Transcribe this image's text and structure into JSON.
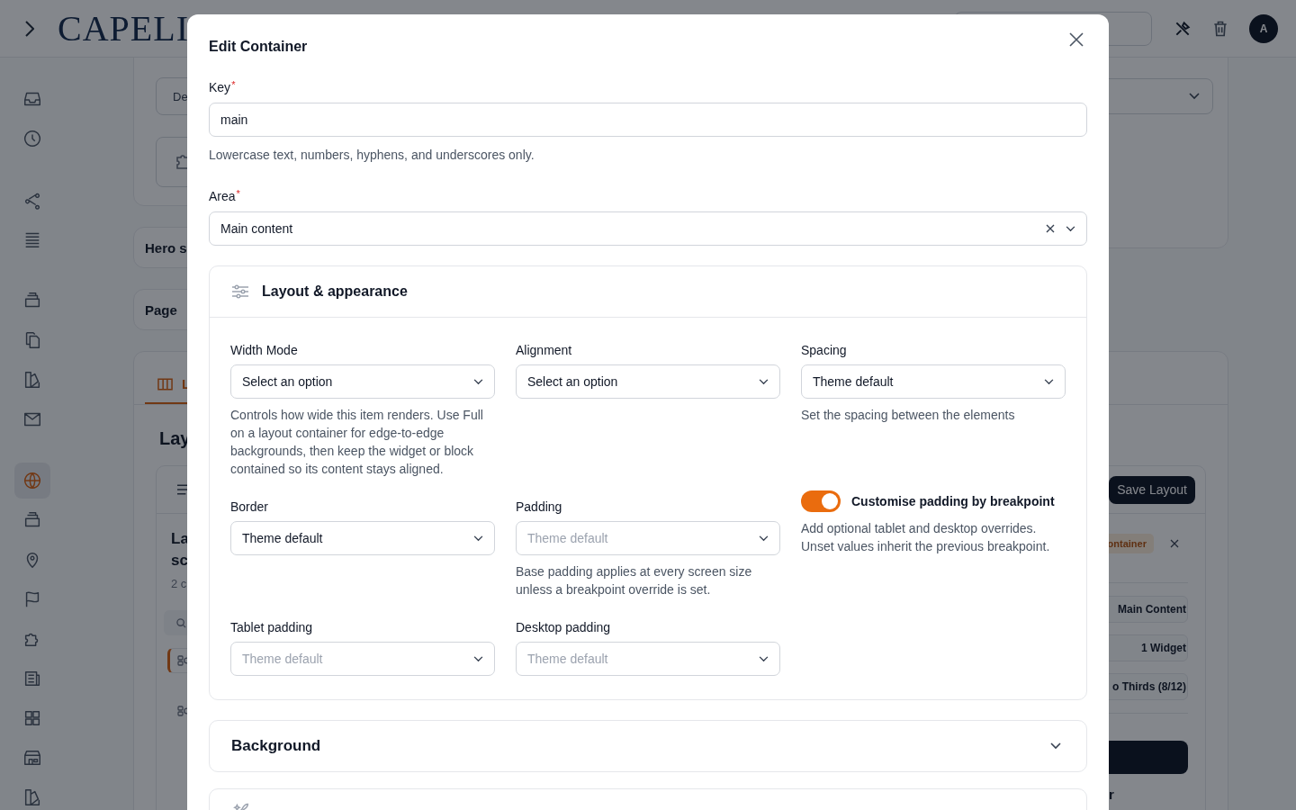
{
  "header": {
    "logo": "CAPELI",
    "avatar": "A"
  },
  "sidebar": {
    "groups": [
      {
        "items": [
          {
            "selected": false
          },
          {
            "selected": false
          }
        ]
      },
      {
        "items": [
          {
            "selected": false
          },
          {
            "selected": false
          }
        ]
      },
      {
        "items": [
          {
            "selected": false
          },
          {
            "selected": false
          },
          {
            "selected": false
          },
          {
            "selected": false
          }
        ]
      },
      {
        "items": [
          {
            "selected": true
          },
          {
            "selected": false
          },
          {
            "selected": false
          },
          {
            "selected": false
          },
          {
            "selected": false
          },
          {
            "selected": false
          },
          {
            "selected": false
          },
          {
            "selected": false
          },
          {
            "selected": false
          }
        ]
      }
    ]
  },
  "backdrop": {
    "field_value": "De",
    "cards": [
      "Hero s",
      "Page"
    ],
    "layout_panel": {
      "tabs": [
        {
          "label": "L",
          "selected": true
        }
      ],
      "heading": "Lay",
      "save_button": "Save Layout",
      "item": {
        "title": "La sc",
        "subtitle": "2 c",
        "badge": "ontainer"
      },
      "widgets": [
        {
          "selected": true
        },
        {
          "selected": false
        }
      ],
      "chips": [
        "Main Content",
        "1 Widget",
        "o Thirds (8/12)"
      ],
      "footer_text": "r"
    }
  },
  "modal": {
    "title": "Edit Container",
    "key": {
      "label": "Key",
      "required_mark": "*",
      "value": "main",
      "help": "Lowercase text, numbers, hyphens, and underscores only."
    },
    "area": {
      "label": "Area",
      "required_mark": "*",
      "value": "Main content",
      "clearable": true
    },
    "sections": [
      {
        "title": "Layout & appearance",
        "expanded": true,
        "fields": [
          {
            "kind": "select",
            "label": "Width Mode",
            "value": "Select an option",
            "help": "Controls how wide this item renders. Use Full on a layout container for edge-to-edge backgrounds, then keep the widget or block contained so its content stays aligned."
          },
          {
            "kind": "select",
            "label": "Alignment",
            "value": "Select an option"
          },
          {
            "kind": "select",
            "label": "Spacing",
            "value": "Theme default",
            "help": "Set the spacing between the elements"
          },
          {
            "kind": "select",
            "label": "Border",
            "value": "Theme default"
          },
          {
            "kind": "select",
            "label": "Padding",
            "placeholder": "Theme default",
            "help": "Base padding applies at every screen size unless a breakpoint override is set."
          },
          {
            "kind": "toggle",
            "label": "Customise padding by breakpoint",
            "on": true,
            "help": "Add optional tablet and desktop overrides. Unset values inherit the previous breakpoint."
          },
          {
            "kind": "select",
            "label": "Tablet padding",
            "placeholder": "Theme default"
          },
          {
            "kind": "select",
            "label": "Desktop padding",
            "placeholder": "Theme default"
          }
        ]
      },
      {
        "title": "Background",
        "expanded": false
      }
    ]
  }
}
